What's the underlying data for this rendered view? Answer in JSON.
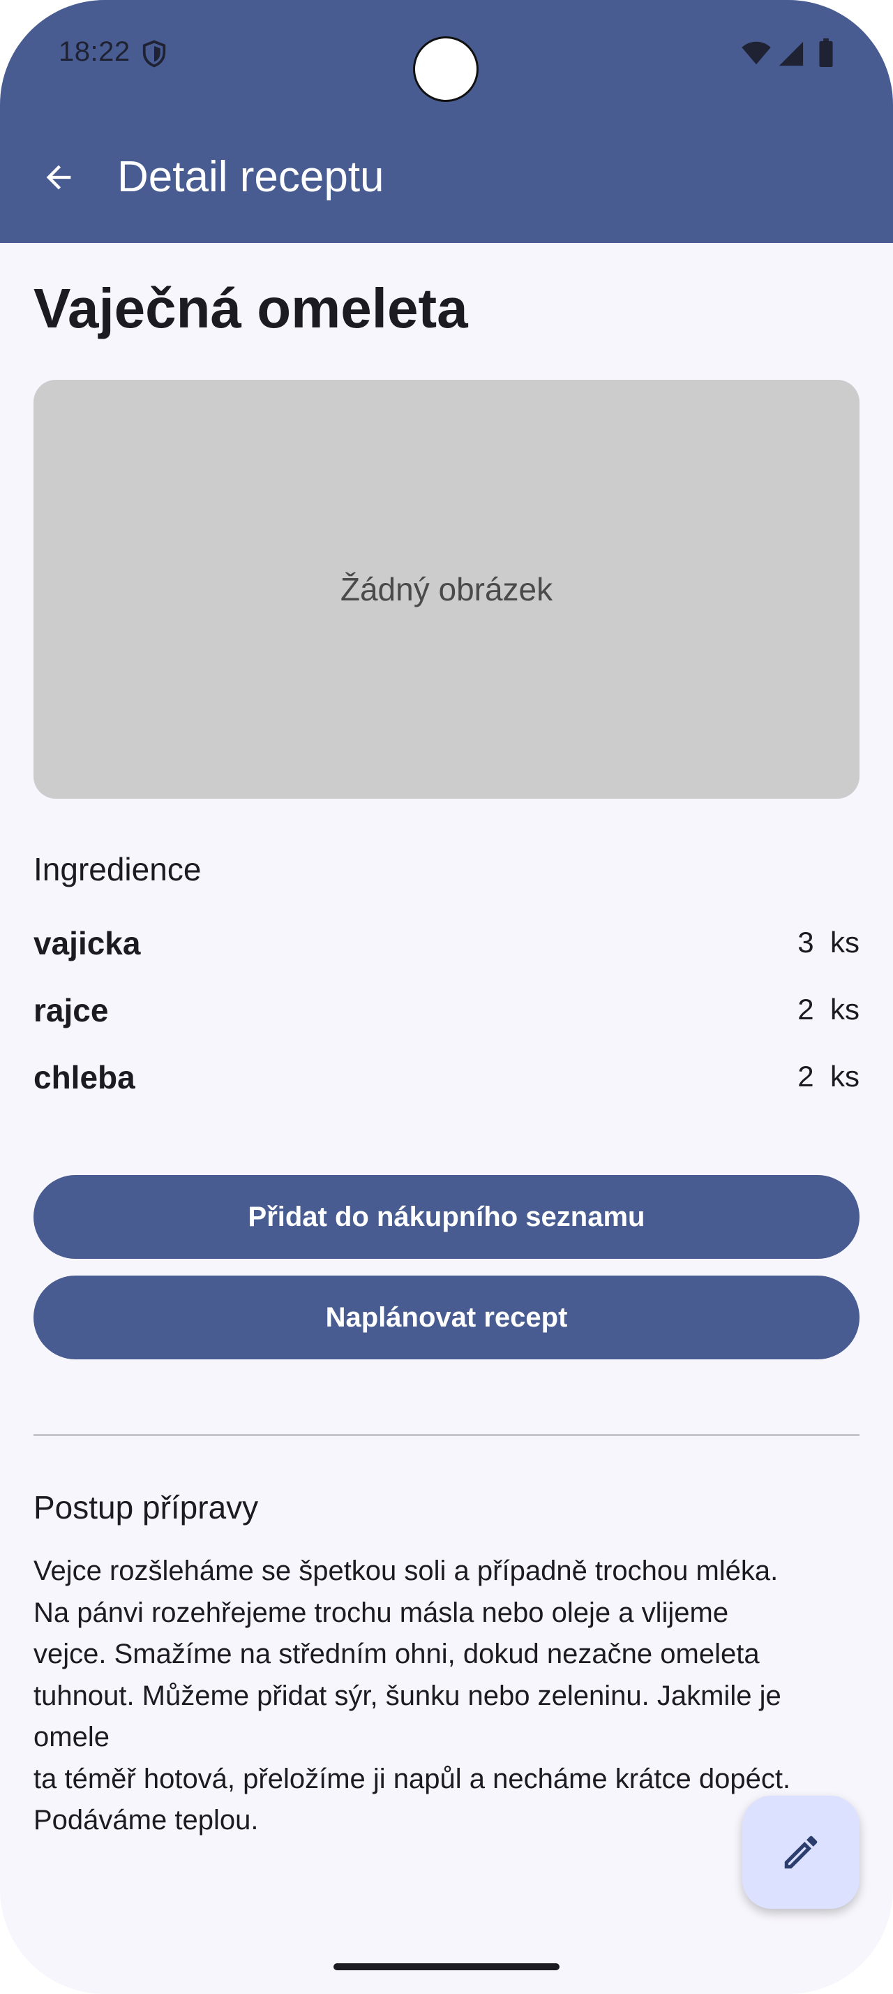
{
  "status_bar": {
    "time": "18:22",
    "icons": [
      "shield-icon",
      "wifi-icon",
      "cellular-signal-icon",
      "battery-icon"
    ]
  },
  "app_bar": {
    "back_icon": "arrow-back-icon",
    "title": "Detail receptu"
  },
  "recipe": {
    "title": "Vaječná omeleta",
    "image_placeholder": "Žádný obrázek"
  },
  "ingredients": {
    "heading": "Ingredience",
    "items": [
      {
        "name": "vajicka",
        "amount": "3",
        "unit": "ks"
      },
      {
        "name": "rajce",
        "amount": "2",
        "unit": "ks"
      },
      {
        "name": "chleba",
        "amount": "2",
        "unit": "ks"
      }
    ]
  },
  "actions": {
    "add_to_shopping_list": "Přidat do nákupního seznamu",
    "schedule_recipe": "Naplánovat recept"
  },
  "preparation": {
    "heading": "Postup přípravy",
    "text": "Vejce rozšleháme se špetkou soli a případně trochou mléka.\nNa pánvi rozehřejeme trochu másla nebo oleje a vlijeme\nvejce. Smažíme na středním ohni, dokud nezačne omeleta\ntuhnout. Můžeme přidat sýr, šunku nebo zeleninu. Jakmile je\nomele\nta téměř hotová, přeložíme ji napůl a necháme krátce dopéct.\nPodáváme teplou."
  },
  "fab": {
    "icon": "edit-pencil-icon"
  },
  "colors": {
    "primary": "#485c92",
    "background": "#f7f6fc",
    "placeholder": "#cccccc",
    "fab": "#dbe1ff"
  }
}
